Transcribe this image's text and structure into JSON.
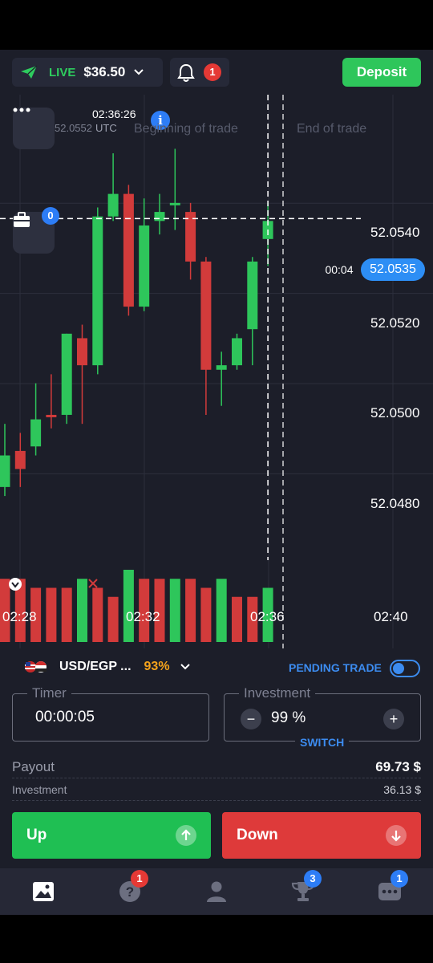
{
  "header": {
    "mode": "LIVE",
    "balance": "$36.50",
    "notifications": "1",
    "deposit_label": "Deposit"
  },
  "chart": {
    "time": "02:36:26",
    "price_faded": "52.0552",
    "utc": "UTC",
    "info": "i",
    "beginning_label": "Beginning of trade",
    "end_label": "End of trade",
    "portfolio_count": "0",
    "countdown": "00:04",
    "current_price": "52.0535",
    "price_ticks": [
      "52.0540",
      "52.0520",
      "52.0500",
      "52.0480"
    ],
    "time_ticks": [
      "02:28",
      "02:32",
      "02:36",
      "02:40"
    ]
  },
  "chart_data": {
    "type": "candlestick",
    "ylim": [
      52.0458,
      52.0563
    ],
    "candles": [
      {
        "o": 52.0476,
        "h": 52.049,
        "l": 52.0474,
        "c": 52.0483,
        "dir": "up"
      },
      {
        "o": 52.0484,
        "h": 52.0488,
        "l": 52.0476,
        "c": 52.048,
        "dir": "down"
      },
      {
        "o": 52.0485,
        "h": 52.0499,
        "l": 52.0483,
        "c": 52.0491,
        "dir": "up"
      },
      {
        "o": 52.0492,
        "h": 52.0501,
        "l": 52.0489,
        "c": 52.0492,
        "dir": "down"
      },
      {
        "o": 52.0492,
        "h": 52.051,
        "l": 52.049,
        "c": 52.051,
        "dir": "up"
      },
      {
        "o": 52.0509,
        "h": 52.0512,
        "l": 52.049,
        "c": 52.0503,
        "dir": "down"
      },
      {
        "o": 52.0503,
        "h": 52.0538,
        "l": 52.0501,
        "c": 52.0536,
        "dir": "up"
      },
      {
        "o": 52.0536,
        "h": 52.055,
        "l": 52.0535,
        "c": 52.0541,
        "dir": "up"
      },
      {
        "o": 52.0541,
        "h": 52.0543,
        "l": 52.0514,
        "c": 52.0516,
        "dir": "down"
      },
      {
        "o": 52.0516,
        "h": 52.054,
        "l": 52.0515,
        "c": 52.0534,
        "dir": "up"
      },
      {
        "o": 52.0535,
        "h": 52.0541,
        "l": 52.0532,
        "c": 52.0537,
        "dir": "up"
      },
      {
        "o": 52.0539,
        "h": 52.0551,
        "l": 52.0533,
        "c": 52.0539,
        "dir": "up"
      },
      {
        "o": 52.0537,
        "h": 52.0539,
        "l": 52.0522,
        "c": 52.0526,
        "dir": "down"
      },
      {
        "o": 52.0526,
        "h": 52.0527,
        "l": 52.0492,
        "c": 52.0502,
        "dir": "down"
      },
      {
        "o": 52.0502,
        "h": 52.0506,
        "l": 52.0494,
        "c": 52.0503,
        "dir": "up"
      },
      {
        "o": 52.0503,
        "h": 52.051,
        "l": 52.0502,
        "c": 52.0509,
        "dir": "up"
      },
      {
        "o": 52.0511,
        "h": 52.0527,
        "l": 52.0503,
        "c": 52.0526,
        "dir": "up"
      },
      {
        "o": 52.0531,
        "h": 52.0539,
        "l": 52.0525,
        "c": 52.0535,
        "dir": "up"
      }
    ],
    "volume": [
      {
        "v": 7,
        "dir": "down"
      },
      {
        "v": 7,
        "dir": "down"
      },
      {
        "v": 6,
        "dir": "down"
      },
      {
        "v": 6,
        "dir": "down"
      },
      {
        "v": 6,
        "dir": "down"
      },
      {
        "v": 7,
        "dir": "up"
      },
      {
        "v": 6,
        "dir": "down"
      },
      {
        "v": 5,
        "dir": "down"
      },
      {
        "v": 8,
        "dir": "up"
      },
      {
        "v": 7,
        "dir": "down"
      },
      {
        "v": 7,
        "dir": "down"
      },
      {
        "v": 7,
        "dir": "up"
      },
      {
        "v": 7,
        "dir": "down"
      },
      {
        "v": 6,
        "dir": "down"
      },
      {
        "v": 7,
        "dir": "up"
      },
      {
        "v": 5,
        "dir": "down"
      },
      {
        "v": 5,
        "dir": "down"
      },
      {
        "v": 6,
        "dir": "up"
      }
    ],
    "price_ticks": [
      52.054,
      52.052,
      52.05,
      52.048
    ],
    "time_ticks": [
      "02:28",
      "02:32",
      "02:36",
      "02:40"
    ],
    "current_price": 52.0535
  },
  "panel": {
    "pair": "USD/EGP ...",
    "payout_pct": "93%",
    "pending_label": "PENDING TRADE",
    "timer_label": "Timer",
    "timer_value": "00:00:05",
    "investment_label": "Investment",
    "investment_value": "99 %",
    "minus": "−",
    "plus": "+",
    "switch_label": "SWITCH",
    "payout_label": "Payout",
    "payout_value": "69.73 $",
    "investment_row_label": "Investment",
    "investment_row_value": "36.13 $",
    "up_label": "Up",
    "down_label": "Down"
  },
  "nav": {
    "help_badge": "1",
    "tournaments_badge": "3",
    "chat_badge": "1"
  },
  "colors": {
    "background": "#1c1e29",
    "bull": "#2ec65b",
    "bear": "#d23b3b",
    "accent": "#2d8ef5",
    "deposit": "#2ec65b",
    "payout_pct": "#f3a21c"
  },
  "icons": {
    "account": "paper-plane-icon",
    "notifications": "bell-icon",
    "menu": "more-icon",
    "portfolio": "briefcase-icon",
    "toggle": "toggle-icon"
  }
}
